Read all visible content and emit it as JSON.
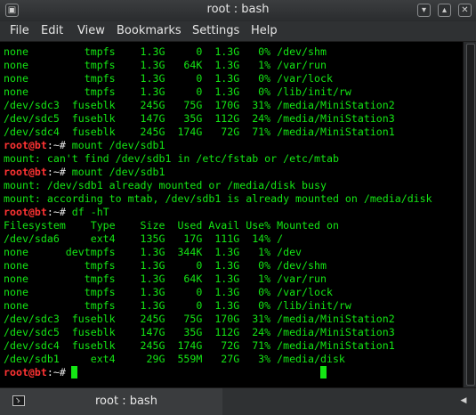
{
  "window": {
    "title": "root : bash",
    "controls": {
      "menu_icon": "terminal-menu-icon",
      "minimize_icon": "minimize-icon",
      "maximize_icon": "maximize-icon",
      "close_icon": "close-icon"
    }
  },
  "menubar": {
    "items": [
      "File",
      "Edit",
      "View",
      "Bookmarks",
      "Settings",
      "Help"
    ]
  },
  "colors": {
    "background": "#000000",
    "output_text": "#14e614",
    "prompt_user": "#ff3333",
    "prompt_path": "#e8e8e8"
  },
  "terminal": {
    "prompt_user": "root@bt",
    "prompt_path": ":~# ",
    "lines": [
      {
        "type": "out",
        "text": "none         tmpfs    1.3G     0  1.3G   0% /dev/shm"
      },
      {
        "type": "out",
        "text": "none         tmpfs    1.3G   64K  1.3G   1% /var/run"
      },
      {
        "type": "out",
        "text": "none         tmpfs    1.3G     0  1.3G   0% /var/lock"
      },
      {
        "type": "out",
        "text": "none         tmpfs    1.3G     0  1.3G   0% /lib/init/rw"
      },
      {
        "type": "out",
        "text": "/dev/sdc3  fuseblk    245G   75G  170G  31% /media/MiniStation2"
      },
      {
        "type": "out",
        "text": "/dev/sdc5  fuseblk    147G   35G  112G  24% /media/MiniStation3"
      },
      {
        "type": "out",
        "text": "/dev/sdc4  fuseblk    245G  174G   72G  71% /media/MiniStation1"
      },
      {
        "type": "cmd",
        "text": "mount /dev/sdb1"
      },
      {
        "type": "out",
        "text": "mount: can't find /dev/sdb1 in /etc/fstab or /etc/mtab"
      },
      {
        "type": "cmd",
        "text": "mount /dev/sdb1"
      },
      {
        "type": "out",
        "text": "mount: /dev/sdb1 already mounted or /media/disk busy"
      },
      {
        "type": "out",
        "text": "mount: according to mtab, /dev/sdb1 is already mounted on /media/disk"
      },
      {
        "type": "cmd",
        "text": "df -hT"
      },
      {
        "type": "out",
        "text": "Filesystem    Type    Size  Used Avail Use% Mounted on"
      },
      {
        "type": "out",
        "text": "/dev/sda6     ext4    135G   17G  111G  14% /"
      },
      {
        "type": "out",
        "text": "none      devtmpfs    1.3G  344K  1.3G   1% /dev"
      },
      {
        "type": "out",
        "text": "none         tmpfs    1.3G     0  1.3G   0% /dev/shm"
      },
      {
        "type": "out",
        "text": "none         tmpfs    1.3G   64K  1.3G   1% /var/run"
      },
      {
        "type": "out",
        "text": "none         tmpfs    1.3G     0  1.3G   0% /var/lock"
      },
      {
        "type": "out",
        "text": "none         tmpfs    1.3G     0  1.3G   0% /lib/init/rw"
      },
      {
        "type": "out",
        "text": "/dev/sdc3  fuseblk    245G   75G  170G  31% /media/MiniStation2"
      },
      {
        "type": "out",
        "text": "/dev/sdc5  fuseblk    147G   35G  112G  24% /media/MiniStation3"
      },
      {
        "type": "out",
        "text": "/dev/sdc4  fuseblk    245G  174G   72G  71% /media/MiniStation1"
      },
      {
        "type": "out",
        "text": "/dev/sdb1     ext4     29G  559M   27G   3% /media/disk"
      },
      {
        "type": "cmd",
        "text": ""
      }
    ]
  },
  "tabbar": {
    "tab_label": "root : bash",
    "tab_icon": "terminal-tab-icon",
    "scroll_icon": "tab-scroll-icon"
  }
}
